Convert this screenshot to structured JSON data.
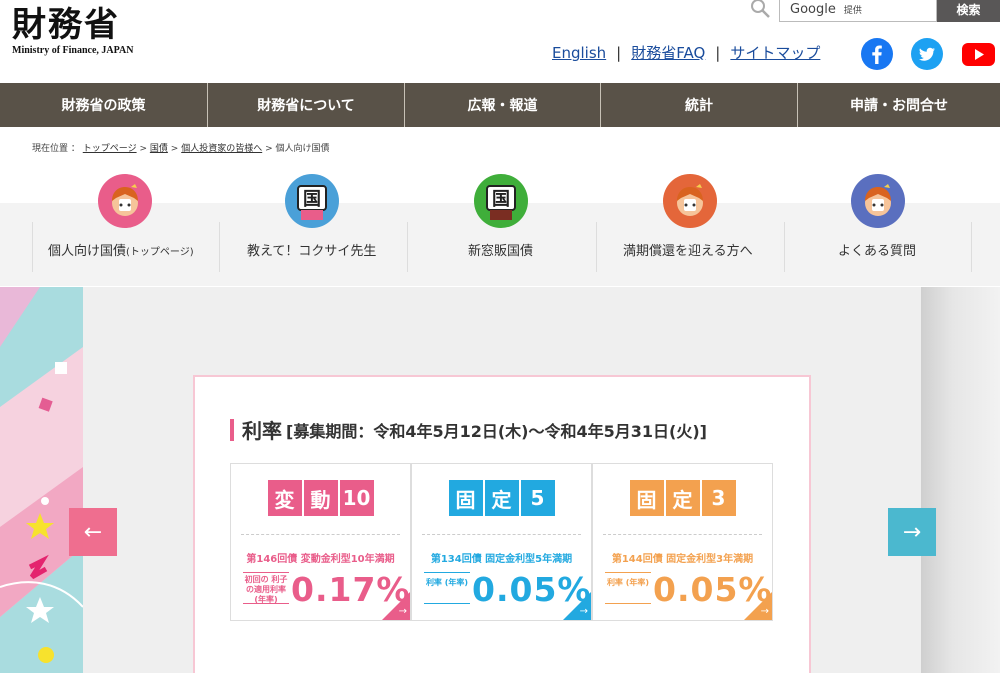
{
  "header": {
    "logo_jp": "財務省",
    "logo_en": "Ministry of Finance, JAPAN",
    "search": {
      "placeholder": "Google",
      "provided_by": "提供",
      "button": "検索"
    },
    "links": [
      {
        "label": "English"
      },
      {
        "label": "財務省FAQ"
      },
      {
        "label": "サイトマップ"
      }
    ],
    "separator": "|"
  },
  "gnav": [
    {
      "label": "財務省の政策"
    },
    {
      "label": "財務省について"
    },
    {
      "label": "広報・報道"
    },
    {
      "label": "統計"
    },
    {
      "label": "申請・お問合せ"
    }
  ],
  "breadcrumb": {
    "prefix": "現在位置 ：",
    "items": [
      "トップページ",
      "国債",
      "個人投資家の皆様へ"
    ],
    "current": "個人向け国債",
    "sep": ">"
  },
  "subnav": [
    {
      "label_main": "個人向け国債",
      "label_small": "(トップページ)"
    },
    {
      "label_main": "教えて！コクサイ先生",
      "label_small": ""
    },
    {
      "label_main": "新窓販国債",
      "label_small": ""
    },
    {
      "label_main": "満期償還を迎える方へ",
      "label_small": ""
    },
    {
      "label_main": "よくある質問",
      "label_small": ""
    }
  ],
  "hero": {
    "heading_main": "利率",
    "heading_period": "[募集期間：令和4年5月12日(木)～令和4年5月31日(火)]",
    "prev": "←",
    "next": "→",
    "bonds": [
      {
        "badge": [
          "変",
          "動",
          "10"
        ],
        "name": "第146回債 変動金利型10年満期",
        "rate_label": "初回の 利子の適用利率 (年率)",
        "rate": "0.17%",
        "color": "#e95d8a"
      },
      {
        "badge": [
          "固",
          "定",
          "5"
        ],
        "name": "第134回債 固定金利型5年満期",
        "rate_label": "利率 (年率)",
        "rate": "0.05%",
        "color": "#22a9e0"
      },
      {
        "badge": [
          "固",
          "定",
          "3"
        ],
        "name": "第144回債 固定金利型3年満期",
        "rate_label": "利率 (年率)",
        "rate": "0.05%",
        "color": "#f3a14f"
      }
    ]
  },
  "colors": {
    "nav_bg": "#595248",
    "link": "#1a4c9c",
    "pink": "#e95d8a",
    "blue": "#22a9e0",
    "orange": "#f3a14f",
    "slider_teal": "#4bb8cf"
  }
}
